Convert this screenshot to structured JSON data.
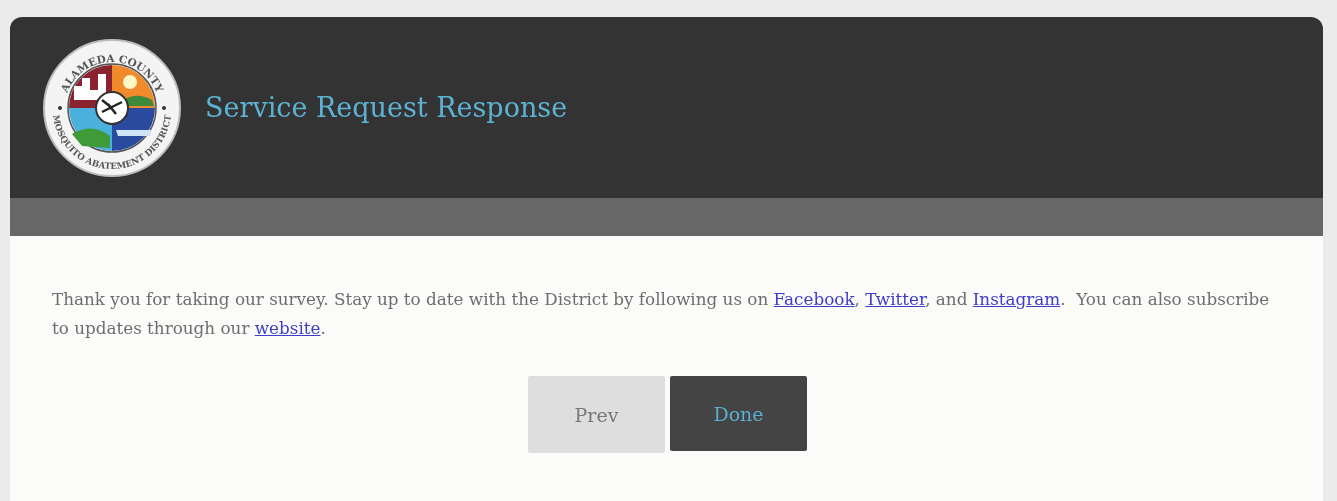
{
  "header": {
    "title": "Service Request Response",
    "logo": {
      "top_text": "ALAMEDA COUNTY",
      "bottom_text": "MOSQUITO ABATEMENT DISTRICT"
    }
  },
  "message": [
    {
      "kind": "text",
      "text": "Thank you for taking our survey. Stay up to date with the District by following us on "
    },
    {
      "kind": "link",
      "text": "Facebook"
    },
    {
      "kind": "text",
      "text": ", "
    },
    {
      "kind": "link",
      "text": "Twitter"
    },
    {
      "kind": "text",
      "text": ", and "
    },
    {
      "kind": "link",
      "text": "Instagram"
    },
    {
      "kind": "text",
      "text": ".  You can also subscribe to updates through our "
    },
    {
      "kind": "link",
      "text": "website"
    },
    {
      "kind": "text",
      "text": "."
    }
  ],
  "buttons": [
    {
      "label": "Prev",
      "kind": "secondary"
    },
    {
      "label": "Done",
      "kind": "primary"
    }
  ]
}
